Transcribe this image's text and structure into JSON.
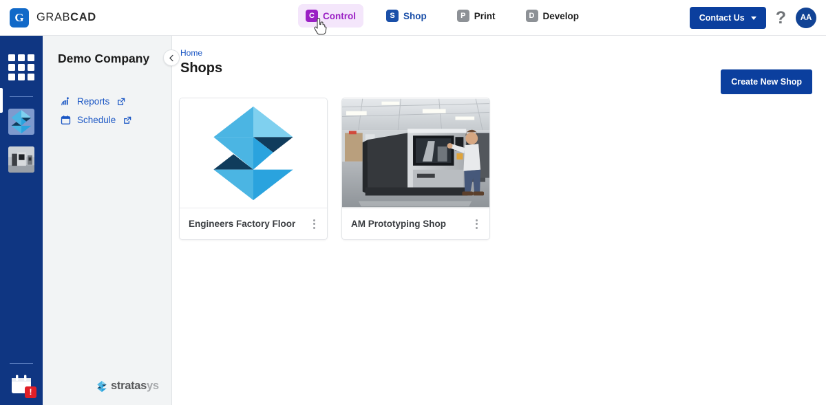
{
  "header": {
    "brand_light": "GRAB",
    "brand_bold": "CAD",
    "brand_mark_letter": "G",
    "tabs": [
      {
        "label": "Control",
        "icon_letter": "C",
        "icon": "control-icon",
        "active": true
      },
      {
        "label": "Shop",
        "icon_letter": "S",
        "icon": "shop-icon",
        "active": false
      },
      {
        "label": "Print",
        "icon_letter": "P",
        "icon": "print-icon",
        "active": false
      },
      {
        "label": "Develop",
        "icon_letter": "D",
        "icon": "develop-icon",
        "active": false
      }
    ],
    "contact_label": "Contact Us",
    "help_glyph": "?",
    "avatar_initials": "AA",
    "cursor": "pointer-hand-cursor"
  },
  "rail": {
    "grid_icon": "apps-grid-icon",
    "thumbs": [
      {
        "name": "rail-thumb-engineers-factory-floor",
        "kind": "stratasys-logo"
      },
      {
        "name": "rail-thumb-am-prototyping-shop",
        "kind": "photo"
      }
    ],
    "schedule_icon": "calendar-icon",
    "alert_badge": "!"
  },
  "sidebar": {
    "company": "Demo Company",
    "collapse_icon": "chevron-left-icon",
    "links": [
      {
        "label": "Reports",
        "icon": "reports-chart-icon",
        "ext_icon": "external-link-icon"
      },
      {
        "label": "Schedule",
        "icon": "calendar-icon",
        "ext_icon": "external-link-icon"
      }
    ],
    "footer_logo_dark": "stratas",
    "footer_logo_light": "ys"
  },
  "main": {
    "breadcrumb": "Home",
    "title": "Shops",
    "create_label": "Create New Shop",
    "cards": [
      {
        "title": "Engineers Factory Floor",
        "media": "stratasys-logo",
        "menu_icon": "kebab-menu-icon"
      },
      {
        "title": "AM Prototyping Shop",
        "media": "printer-lab-photo",
        "menu_icon": "kebab-menu-icon"
      }
    ]
  },
  "colors": {
    "brand_blue": "#1169c8",
    "nav_rail": "#0f3682",
    "primary_button": "#0b3f9e",
    "link": "#1a56c4",
    "control_purple": "#9a1fc4",
    "control_tab_bg": "#f4e6fb",
    "shop_blue": "#1a4fa8",
    "inactive_gray": "#8d9196",
    "sidebar_bg": "#f2f4f5",
    "alert_red": "#e01f27",
    "logo_light_blue": "#4bb5e3",
    "logo_mid_blue": "#2aa3de",
    "logo_dark_navy": "#103c5c"
  }
}
